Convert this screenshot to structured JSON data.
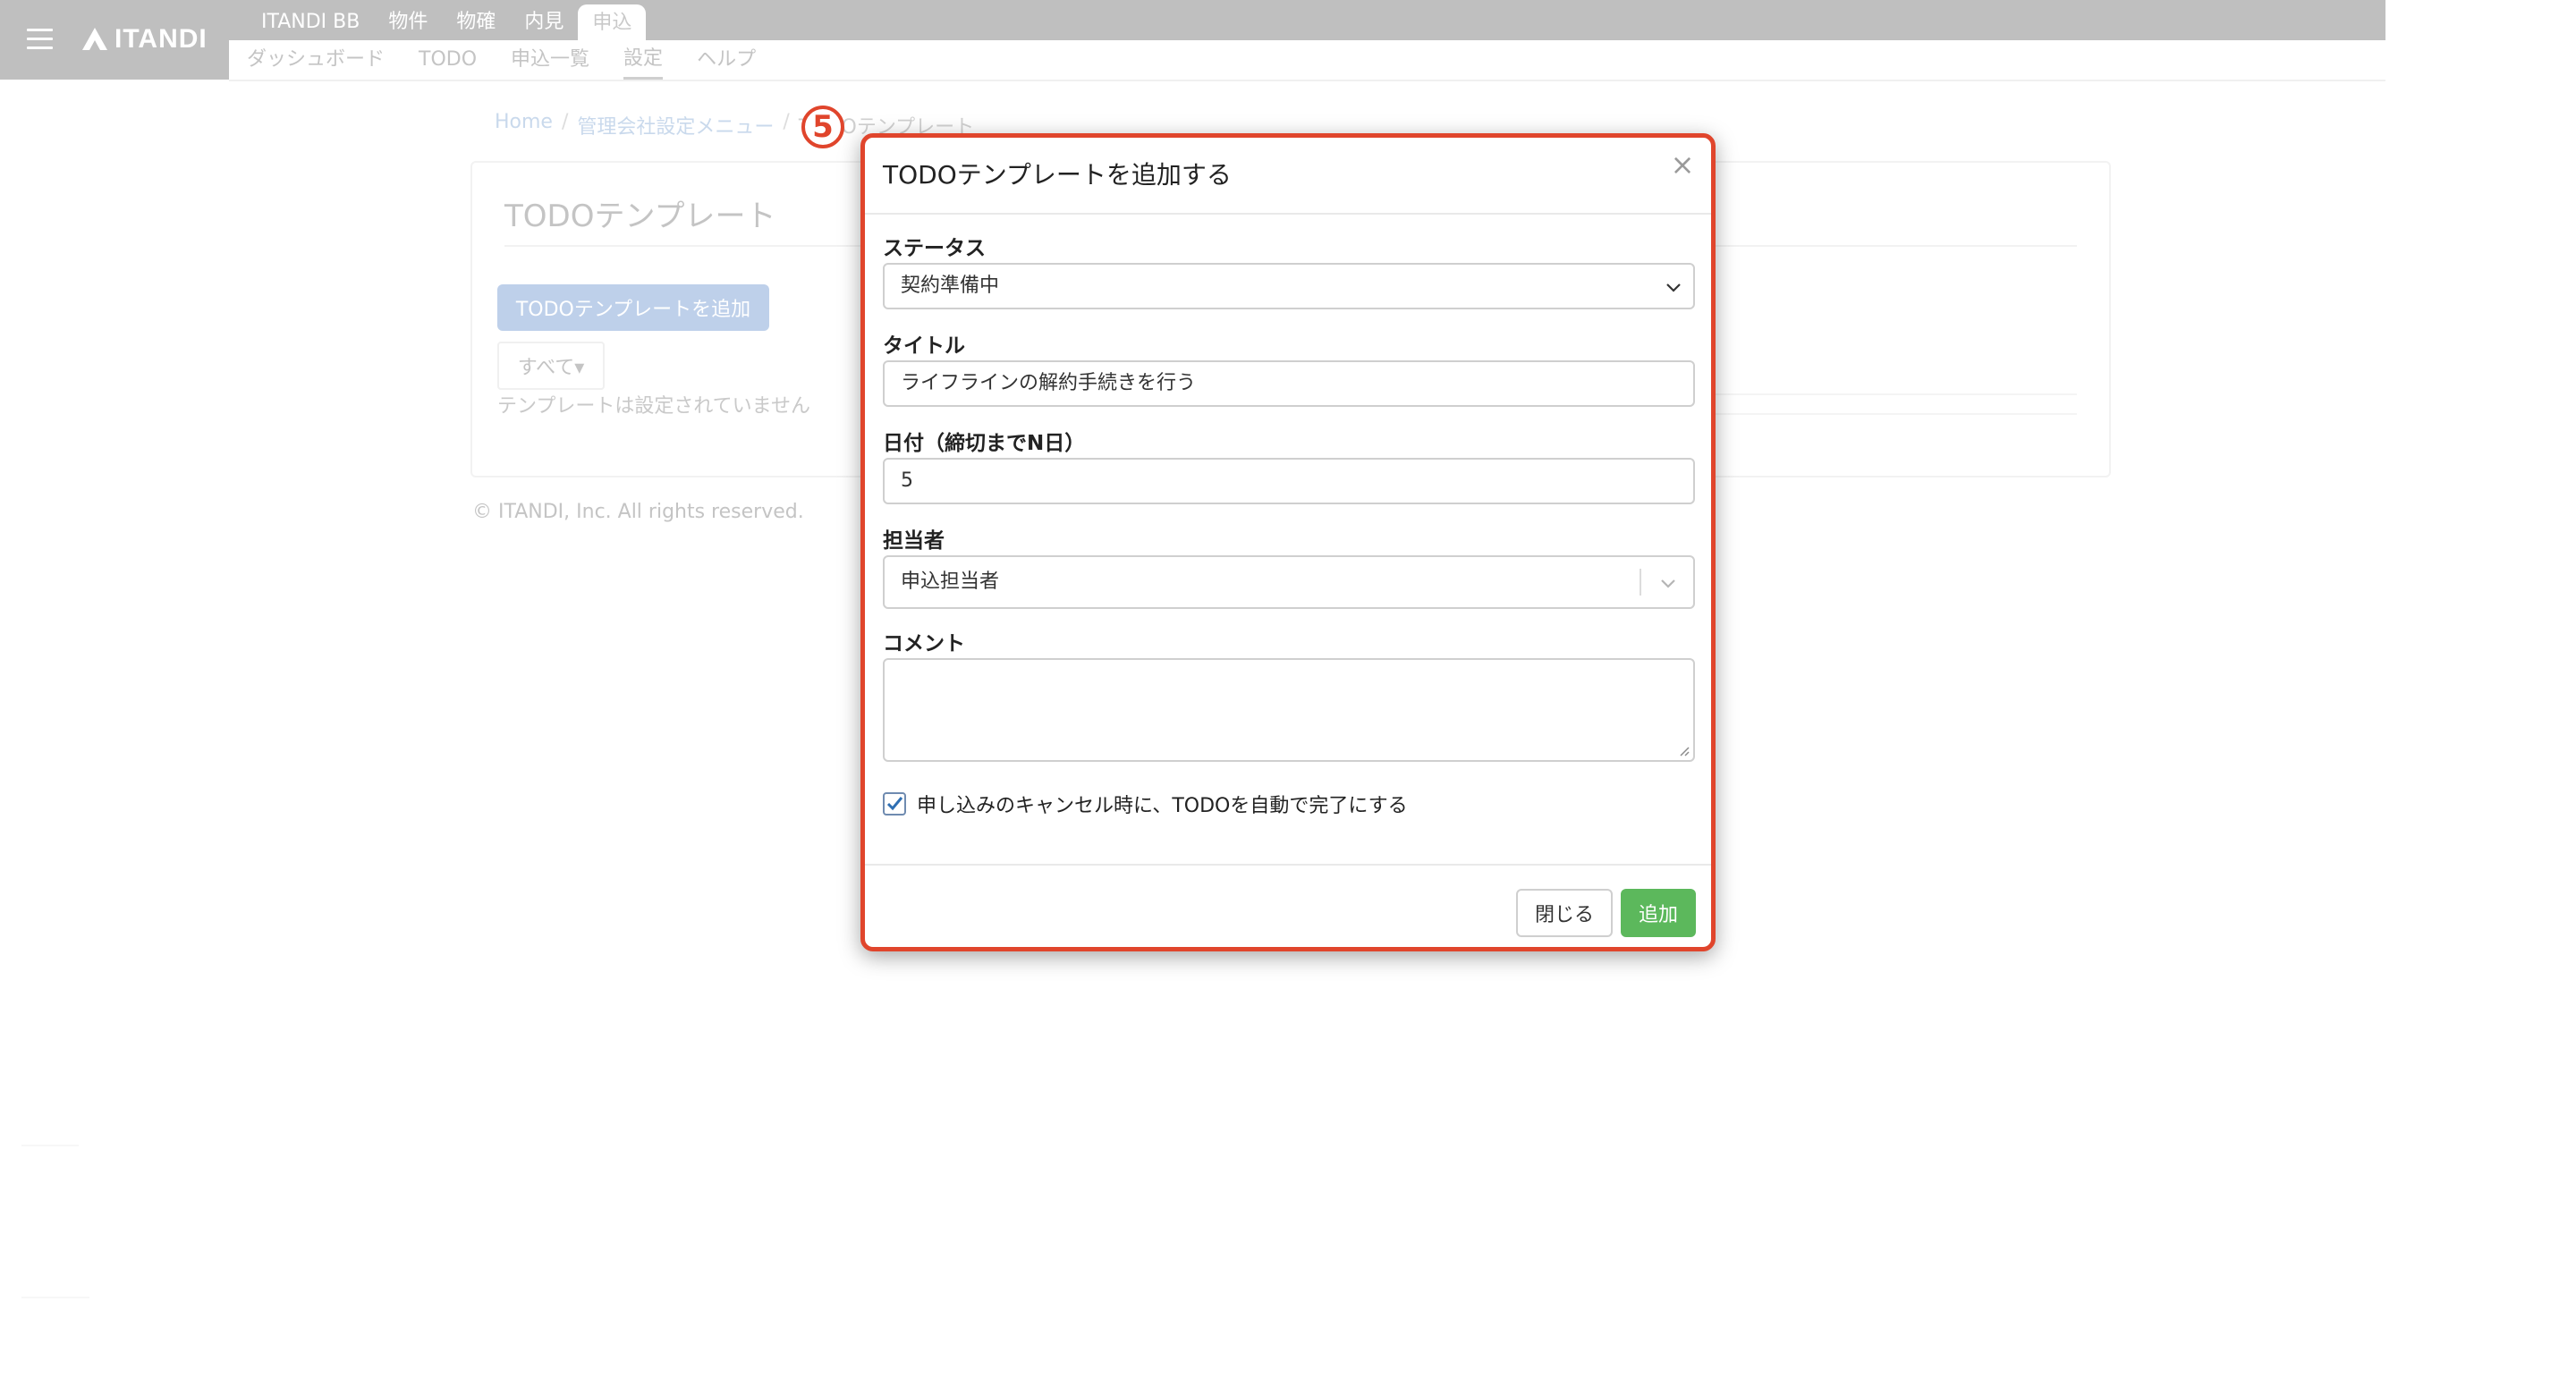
{
  "header": {
    "logo_text": "ITANDI",
    "tabs": [
      "ITANDI BB",
      "物件",
      "物確",
      "内見",
      "申込"
    ],
    "active_tab": "申込"
  },
  "subnav": {
    "items": [
      "ダッシュボード",
      "TODO",
      "申込一覧",
      "設定",
      "ヘルプ"
    ],
    "active_item": "設定"
  },
  "breadcrumb": {
    "items": [
      "Home",
      "管理会社設定メニュー",
      "TODOテンプレート"
    ],
    "separator": "/"
  },
  "panel": {
    "title": "TODOテンプレート",
    "add_button": "TODOテンプレートを追加",
    "filter_button": "すべて▾",
    "empty_text": "テンプレートは設定されていません"
  },
  "footer": {
    "text": "© ITANDI, Inc. All rights reserved."
  },
  "modal": {
    "step_badge": "5",
    "title": "TODOテンプレートを追加する",
    "close_glyph": "×",
    "status": {
      "label": "ステータス",
      "value": "契約準備中"
    },
    "title_field": {
      "label": "タイトル",
      "value": "ライフラインの解約手続きを行う"
    },
    "date": {
      "label": "日付（締切までN日）",
      "value": "5"
    },
    "assignee": {
      "label": "担当者",
      "value": "申込担当者"
    },
    "comment": {
      "label": "コメント",
      "value": ""
    },
    "auto_complete": {
      "label": "申し込みのキャンセル時に、TODOを自動で完了にする",
      "checked": true
    },
    "buttons": {
      "close": "閉じる",
      "add": "追加"
    }
  },
  "colors": {
    "highlight": "#e0452c",
    "primary_add": "#5cb85c",
    "topbar": "#bfbfbf"
  },
  "icons": [
    "hamburger-icon",
    "itandi-logo-icon",
    "close-icon",
    "chevron-down-icon",
    "check-icon",
    "resize-grip-icon"
  ]
}
